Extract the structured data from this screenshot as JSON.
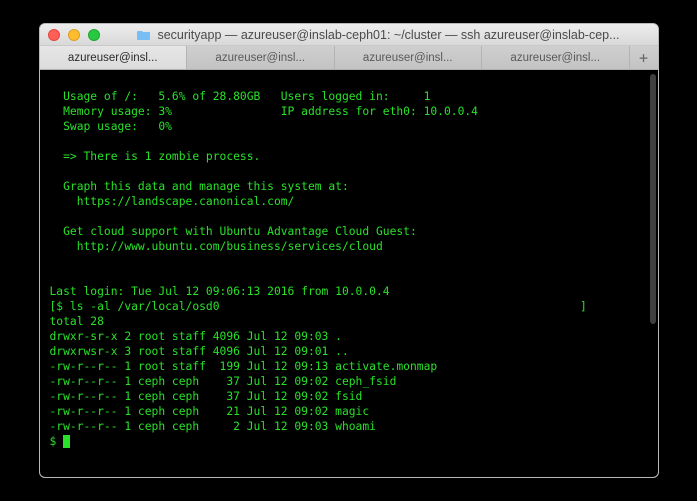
{
  "window": {
    "title": "securityapp — azureuser@inslab-ceph01: ~/cluster — ssh azureuser@inslab-cep..."
  },
  "tabs": [
    {
      "label": "azureuser@insl...",
      "active": true
    },
    {
      "label": "azureuser@insl...",
      "active": false
    },
    {
      "label": "azureuser@insl...",
      "active": false
    },
    {
      "label": "azureuser@insl...",
      "active": false
    }
  ],
  "newtab_label": "+",
  "terminal": {
    "l01": "  Usage of /:   5.6% of 28.80GB   Users logged in:     1",
    "l02": "  Memory usage: 3%                IP address for eth0: 10.0.0.4",
    "l03": "  Swap usage:   0%",
    "l04": "",
    "l05": "  => There is 1 zombie process.",
    "l06": "",
    "l07": "  Graph this data and manage this system at:",
    "l08": "    https://landscape.canonical.com/",
    "l09": "",
    "l10": "  Get cloud support with Ubuntu Advantage Cloud Guest:",
    "l11": "    http://www.ubuntu.com/business/services/cloud",
    "l12": "",
    "l13": "",
    "l14": "Last login: Tue Jul 12 09:06:13 2016 from 10.0.0.4",
    "l15": "[$ ls -al /var/local/osd0                                                     ]",
    "l16": "total 28",
    "l17": "drwxr-sr-x 2 root staff 4096 Jul 12 09:03 .",
    "l18": "drwxrwsr-x 3 root staff 4096 Jul 12 09:01 ..",
    "l19": "-rw-r--r-- 1 root staff  199 Jul 12 09:13 activate.monmap",
    "l20": "-rw-r--r-- 1 ceph ceph    37 Jul 12 09:02 ceph_fsid",
    "l21": "-rw-r--r-- 1 ceph ceph    37 Jul 12 09:02 fsid",
    "l22": "-rw-r--r-- 1 ceph ceph    21 Jul 12 09:02 magic",
    "l23": "-rw-r--r-- 1 ceph ceph     2 Jul 12 09:03 whoami",
    "prompt": "$ "
  }
}
